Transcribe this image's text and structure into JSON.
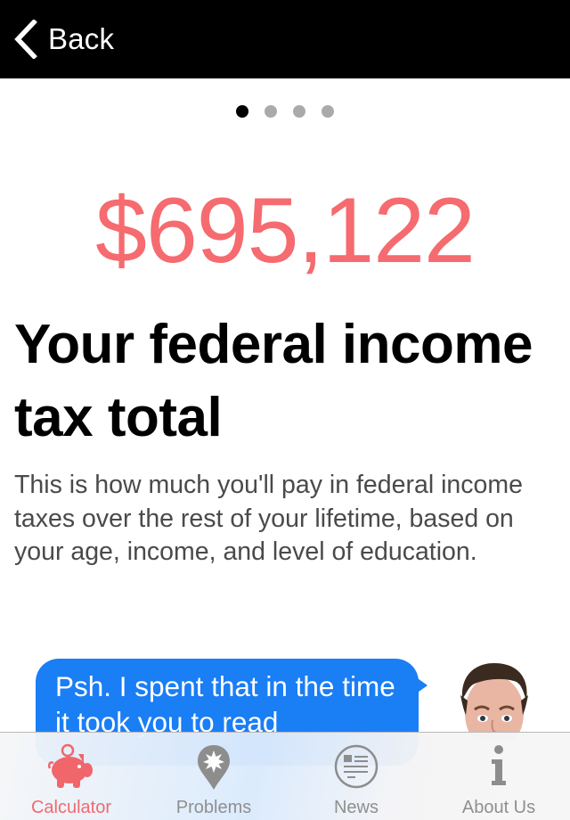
{
  "navbar": {
    "back_label": "Back",
    "back_icon": "chevron-left-icon"
  },
  "pager": {
    "total_pages": 4,
    "current_page": 1
  },
  "result": {
    "amount": "$695,122",
    "title": "Your federal income tax total",
    "description": "This is how much you'll pay in federal income taxes over the rest of your lifetime, based on your age, income, and level of education."
  },
  "message": {
    "text": "Psh. I spent that in the time it took you to read",
    "avatar": "person-face-photo"
  },
  "tabbar": {
    "tabs": [
      {
        "label": "Calculator",
        "icon": "piggy-bank-icon",
        "active": true
      },
      {
        "label": "Problems",
        "icon": "map-pin-burst-icon",
        "active": false
      },
      {
        "label": "News",
        "icon": "newspaper-icon",
        "active": false
      },
      {
        "label": "About Us",
        "icon": "info-icon",
        "active": false
      }
    ]
  },
  "colors": {
    "accent": "#f56b6f",
    "bubble": "#1a7ef5",
    "inactive": "#8f8f8f",
    "navbar": "#000000"
  }
}
